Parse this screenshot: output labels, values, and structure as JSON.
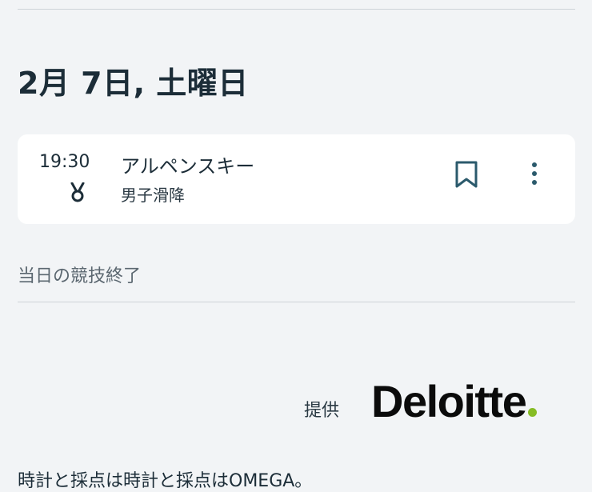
{
  "schedule": {
    "date_heading": "2月 7日, 土曜日",
    "event": {
      "time": "19:30",
      "sport": "アルペンスキー",
      "discipline": "男子滑降",
      "icons": {
        "medal": "medal-icon",
        "bookmark": "bookmark-icon",
        "more": "more-vertical-icon"
      }
    },
    "status": "当日の競技終了"
  },
  "sponsor": {
    "label": "提供",
    "logo_text": "Deloitte",
    "logo_dot_color": "#86bc25"
  },
  "footer": {
    "timing_text": "時計と採点は時計と採点はOMEGA。"
  },
  "colors": {
    "background": "#f2f4f6",
    "card": "#ffffff",
    "primary_text": "#1c2d38",
    "icon_teal": "#2b5a6c"
  }
}
